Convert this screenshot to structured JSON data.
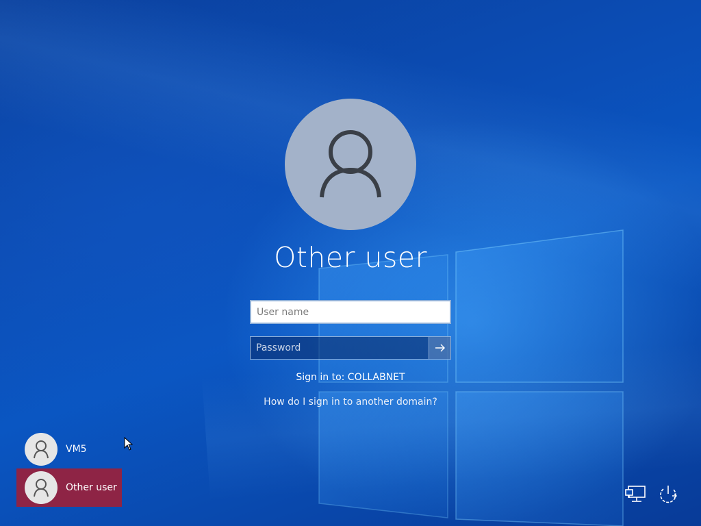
{
  "login": {
    "title": "Other user",
    "username_placeholder": "User name",
    "password_placeholder": "Password",
    "signin_to": "Sign in to: COLLABNET",
    "other_domain_link": "How do I sign in to another domain?"
  },
  "users": [
    {
      "name": "VM5",
      "selected": false
    },
    {
      "name": "Other user",
      "selected": true
    }
  ],
  "icons": {
    "avatar": "user-silhouette-icon",
    "submit": "arrow-right-icon",
    "network": "network-icon",
    "power": "power-icon"
  },
  "colors": {
    "selected_tile": "#8e2445",
    "avatar_bg": "#a3b2c9"
  }
}
